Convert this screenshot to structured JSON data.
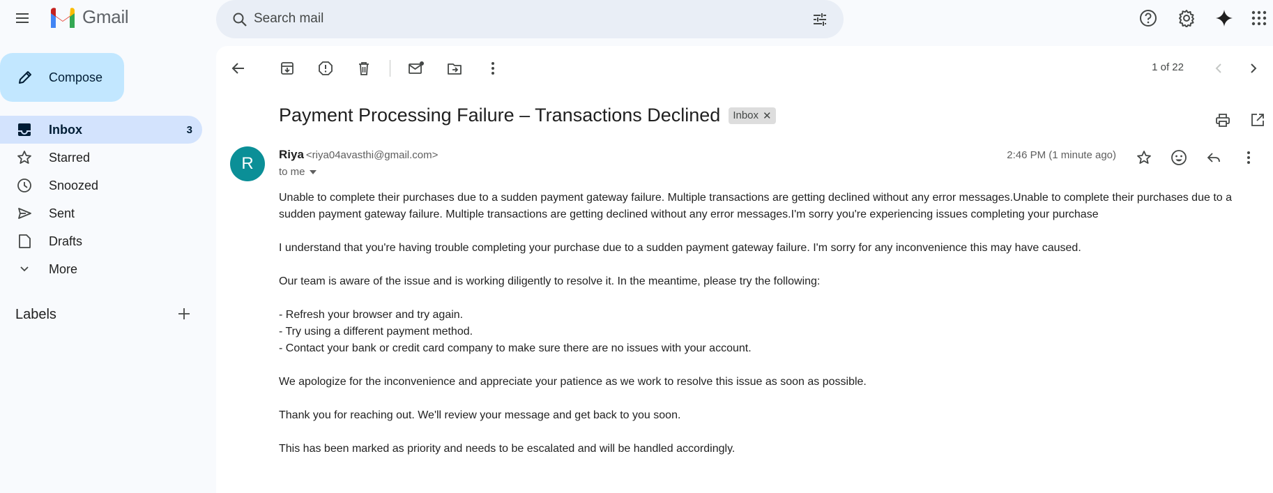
{
  "app": {
    "name": "Gmail",
    "accent_red": "#ea4335",
    "active_bg": "#d3e3fd",
    "compose_bg": "#c2e7ff",
    "avatar_color": "#0b8f97"
  },
  "header": {
    "search_placeholder": "Search mail",
    "icons": [
      "main-menu-icon",
      "search-icon",
      "search-options-icon",
      "help-icon",
      "settings-icon",
      "gemini-icon",
      "apps-icon"
    ]
  },
  "sidebar": {
    "compose_label": "Compose",
    "items": [
      {
        "label": "Inbox",
        "count": "3",
        "icon": "inbox-icon",
        "active": true
      },
      {
        "label": "Starred",
        "count": "",
        "icon": "star-icon"
      },
      {
        "label": "Snoozed",
        "count": "",
        "icon": "clock-icon"
      },
      {
        "label": "Sent",
        "count": "",
        "icon": "send-icon"
      },
      {
        "label": "Drafts",
        "count": "",
        "icon": "draft-icon"
      },
      {
        "label": "More",
        "count": "",
        "icon": "chevron-down-icon"
      }
    ],
    "labels_title": "Labels"
  },
  "toolbar": {
    "pager": "1 of 22",
    "icons": [
      "back-icon",
      "archive-icon",
      "report-spam-icon",
      "delete-icon",
      "mark-unread-icon",
      "move-to-icon",
      "more-vert-icon",
      "newer-icon",
      "older-icon"
    ]
  },
  "message": {
    "subject": "Payment Processing Failure – Transactions Declined",
    "label_chip": "Inbox",
    "sender_initial": "R",
    "sender_name": "Riya",
    "sender_email": "<riya04avasthi@gmail.com>",
    "recipient": "to me",
    "timestamp": "2:46 PM (1 minute ago)",
    "body": {
      "p1": "Unable to complete their purchases due to a sudden payment gateway failure. Multiple transactions are getting declined without any error messages.Unable to complete their purchases due to a sudden payment gateway failure. Multiple transactions are getting declined without any error messages.I'm sorry you're experiencing issues completing your purchase",
      "p2": "I understand that you're having trouble completing your purchase due to a sudden payment gateway failure. I'm sorry for any inconvenience this may have caused.",
      "p3": "Our team is aware of the issue and is working diligently to resolve it. In the meantime, please try the following:",
      "list": [
        "- Refresh your browser and try again.",
        "- Try using a different payment method.",
        "- Contact your bank or credit card company to make sure there are no issues with your account."
      ],
      "p4": "We apologize for the inconvenience and appreciate your patience as we work to resolve this issue as soon as possible.",
      "p5": "Thank you for reaching out. We'll review your message and get back to you soon.",
      "p6": "This has been marked as priority and needs to be escalated and will be handled accordingly."
    }
  }
}
